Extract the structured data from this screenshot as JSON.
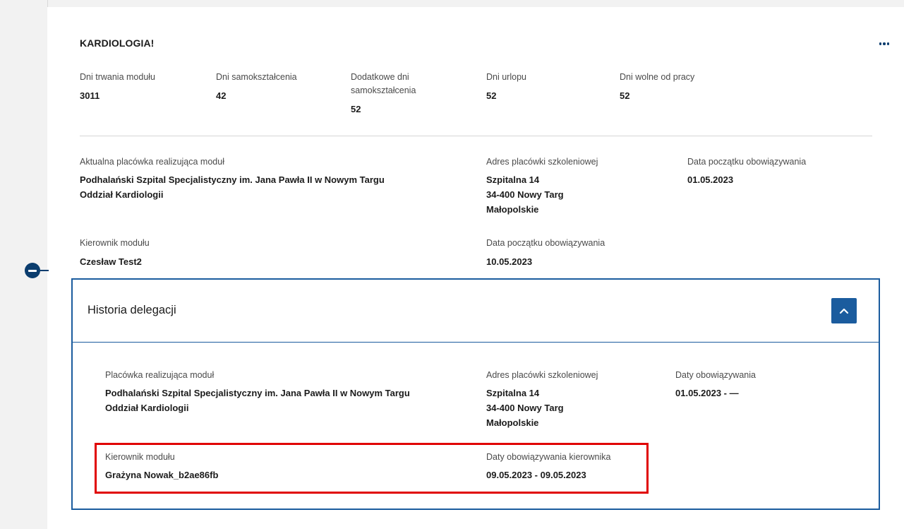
{
  "module": {
    "title": "KARDIOLOGIA!",
    "more_icon": "more-horizontal-icon"
  },
  "stats": [
    {
      "label": "Dni trwania modułu",
      "value": "3011"
    },
    {
      "label": "Dni samokształcenia",
      "value": "42"
    },
    {
      "label_line1": "Dodatkowe dni",
      "label_line2": "samokształcenia",
      "value": "52"
    },
    {
      "label": "Dni urlopu",
      "value": "52"
    },
    {
      "label": "Dni wolne od pracy",
      "value": "52"
    }
  ],
  "facility": {
    "label": "Aktualna placówka realizująca moduł",
    "name_line1": "Podhalański Szpital Specjalistyczny im. Jana Pawła II w Nowym Targu",
    "name_line2": "Oddział Kardiologii",
    "address_label": "Adres placówki szkoleniowej",
    "address_line1": "Szpitalna 14",
    "address_line2": "34-400 Nowy Targ",
    "address_line3": "Małopolskie",
    "start_label": "Data początku obowiązywania",
    "start_value": "01.05.2023"
  },
  "manager": {
    "label": "Kierownik modułu",
    "name": "Czesław Test2",
    "start_label": "Data początku obowiązywania",
    "start_value": "10.05.2023"
  },
  "history": {
    "title": "Historia delegacji",
    "collapse_icon": "chevron-up-icon",
    "facility_label": "Placówka realizująca moduł",
    "facility_line1": "Podhalański Szpital Specjalistyczny im. Jana Pawła II w Nowym Targu",
    "facility_line2": "Oddział Kardiologii",
    "address_label": "Adres placówki szkoleniowej",
    "address_line1": "Szpitalna 14",
    "address_line2": "34-400 Nowy Targ",
    "address_line3": "Małopolskie",
    "dates_label": "Daty obowiązywania",
    "dates_value": "01.05.2023 - —",
    "manager_label": "Kierownik modułu",
    "manager_name": "Grażyna Nowak_b2ae86fb",
    "manager_dates_label": "Daty obowiązywania kierownika",
    "manager_dates_value": "09.05.2023 - 09.05.2023"
  },
  "colors": {
    "accent": "#1b5c9e",
    "timeline_marker": "#0b3d6e",
    "highlight": "#e00000"
  }
}
